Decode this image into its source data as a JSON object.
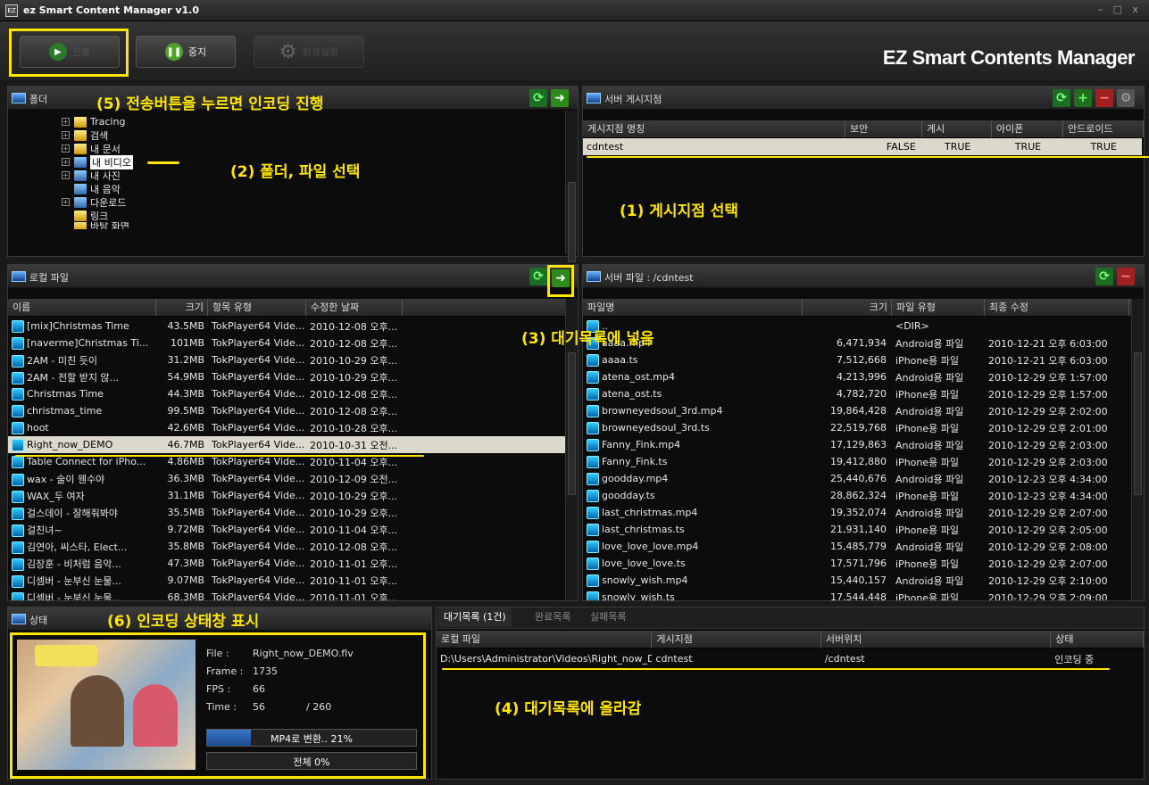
{
  "app": {
    "title": "ez Smart Content Manager v1.0",
    "icon_text": "EZ",
    "window_controls": "– □ x",
    "brand": "EZ Smart Contents Manager"
  },
  "toolbar": {
    "send_label": "전송",
    "stop_label": "중지",
    "settings_label": "환경설정"
  },
  "annotations": {
    "a1": "(1) 게시지점 선택",
    "a2": "(2) 폴더, 파일 선택",
    "a3": "(3) 대기목록에 넣음",
    "a4": "(4) 대기목록에 올라감",
    "a5": "(5) 전송버튼을 누르면 인코딩 진행",
    "a6": "(6) 인코딩 상태창 표시"
  },
  "folder_panel": {
    "title": "폴더",
    "tree": [
      "Tracing",
      "검색",
      "내 문서",
      "내 비디오",
      "내 사진",
      "내 음악",
      "다운로드",
      "링크",
      "바탕 화면"
    ]
  },
  "server_points": {
    "title": "서버 게시지점",
    "columns": [
      "게시지점 명칭",
      "보안",
      "게시",
      "아이폰",
      "안드로이드"
    ],
    "rows": [
      [
        "cdntest",
        "FALSE",
        "TRUE",
        "TRUE",
        "TRUE"
      ]
    ]
  },
  "local_files": {
    "title": "로컬 파일",
    "columns": [
      "이름",
      "크기",
      "항목 유형",
      "수정한 날짜"
    ],
    "rows": [
      [
        "[mix]Christmas Time",
        "43.5MB",
        "TokPlayer64 Vide...",
        "2010-12-08 오후..."
      ],
      [
        "[naverme]Christmas Ti...",
        "101MB",
        "TokPlayer64 Vide...",
        "2010-12-08 오후..."
      ],
      [
        "2AM - 미친 듯이",
        "31.2MB",
        "TokPlayer64 Vide...",
        "2010-10-29 오후..."
      ],
      [
        "2AM - 전할 받지 않...",
        "54.9MB",
        "TokPlayer64 Vide...",
        "2010-10-29 오후..."
      ],
      [
        "Christmas Time",
        "44.3MB",
        "TokPlayer64 Vide...",
        "2010-12-08 오후..."
      ],
      [
        "christmas_time",
        "99.5MB",
        "TokPlayer64 Vide...",
        "2010-12-08 오후..."
      ],
      [
        "hoot",
        "42.6MB",
        "TokPlayer64 Vide...",
        "2010-10-28 오후..."
      ],
      [
        "Right_now_DEMO",
        "46.7MB",
        "TokPlayer64 Vide...",
        "2010-10-31 오전..."
      ],
      [
        "Table Connect for iPho...",
        "4.86MB",
        "TokPlayer64 Vide...",
        "2010-11-04 오후..."
      ],
      [
        "wax - 술이 웬수야",
        "36.3MB",
        "TokPlayer64 Vide...",
        "2010-12-09 오전..."
      ],
      [
        "WAX_두 여자",
        "31.1MB",
        "TokPlayer64 Vide...",
        "2010-10-29 오후..."
      ],
      [
        "걸스데이 - 잘해줘봐야",
        "35.5MB",
        "TokPlayer64 Vide...",
        "2010-10-29 오후..."
      ],
      [
        "걸친녀~",
        "9.72MB",
        "TokPlayer64 Vide...",
        "2010-11-04 오후..."
      ],
      [
        "김연아, 씨스타, Elect...",
        "35.8MB",
        "TokPlayer64 Vide...",
        "2010-12-08 오후..."
      ],
      [
        "김장훈 - 비처럼 음악...",
        "47.3MB",
        "TokPlayer64 Vide...",
        "2010-11-01 오후..."
      ],
      [
        "디셈버 - 눈부신 눈물...",
        "9.07MB",
        "TokPlayer64 Vide...",
        "2010-11-01 오후..."
      ],
      [
        "디셈버 - 눈부신 눈물...",
        "68.3MB",
        "TokPlayer64 Vide...",
        "2010-11-01 오후..."
      ]
    ]
  },
  "server_files": {
    "title": "서버 파일 : /cdntest",
    "columns": [
      "파일명",
      "크기",
      "파일 유형",
      "최종 수정"
    ],
    "rows": [
      [
        "..",
        "",
        "<DIR>",
        ""
      ],
      [
        "aaaa.mp4",
        "6,471,934",
        "Android용 파일",
        "2010-12-21 오후 6:03:00"
      ],
      [
        "aaaa.ts",
        "7,512,668",
        "iPhone용 파일",
        "2010-12-21 오후 6:03:00"
      ],
      [
        "atena_ost.mp4",
        "4,213,996",
        "Android용 파일",
        "2010-12-29 오후 1:57:00"
      ],
      [
        "atena_ost.ts",
        "4,782,720",
        "iPhone용 파일",
        "2010-12-29 오후 1:57:00"
      ],
      [
        "browneyedsoul_3rd.mp4",
        "19,864,428",
        "Android용 파일",
        "2010-12-29 오후 2:02:00"
      ],
      [
        "browneyedsoul_3rd.ts",
        "22,519,768",
        "iPhone용 파일",
        "2010-12-29 오후 2:01:00"
      ],
      [
        "Fanny_Fink.mp4",
        "17,129,863",
        "Android용 파일",
        "2010-12-29 오후 2:03:00"
      ],
      [
        "Fanny_Fink.ts",
        "19,412,880",
        "iPhone용 파일",
        "2010-12-29 오후 2:03:00"
      ],
      [
        "goodday.mp4",
        "25,440,676",
        "Android용 파일",
        "2010-12-23 오후 4:34:00"
      ],
      [
        "goodday.ts",
        "28,862,324",
        "iPhone용 파일",
        "2010-12-23 오후 4:34:00"
      ],
      [
        "last_christmas.mp4",
        "19,352,074",
        "Android용 파일",
        "2010-12-29 오후 2:07:00"
      ],
      [
        "last_christmas.ts",
        "21,931,140",
        "iPhone용 파일",
        "2010-12-29 오후 2:05:00"
      ],
      [
        "love_love_love.mp4",
        "15,485,779",
        "Android용 파일",
        "2010-12-29 오후 2:08:00"
      ],
      [
        "love_love_love.ts",
        "17,571,796",
        "iPhone용 파일",
        "2010-12-29 오후 2:07:00"
      ],
      [
        "snowly_wish.mp4",
        "15,440,157",
        "Android용 파일",
        "2010-12-29 오후 2:10:00"
      ],
      [
        "snowly_wish.ts",
        "17,544,448",
        "iPhone용 파일",
        "2010-12-29 오후 2:09:00"
      ]
    ]
  },
  "status": {
    "title": "상태",
    "file_label": "File :",
    "file_value": "Right_now_DEMO.flv",
    "frame_label": "Frame :",
    "frame_value": "1735",
    "fps_label": "FPS :",
    "fps_value": "66",
    "time_label": "Time :",
    "time_value": "56",
    "time_total": "/ 260",
    "progress_text": "MP4로 변환.. 21%",
    "progress_fraction": 0.21,
    "total_text": "전체 0%",
    "total_fraction": 0.0
  },
  "queue": {
    "tabs": [
      "대기목록 (1건)",
      "완료목록",
      "실패목록"
    ],
    "columns": [
      "로컬 파일",
      "게시지점",
      "서버위치",
      "상태"
    ],
    "rows": [
      [
        "D:\\Users\\Administrator\\Videos\\Right_now_D...",
        "cdntest",
        "/cdntest",
        "인코딩 중"
      ]
    ]
  },
  "colors": {
    "annotation": "#ffe600",
    "selected_row": "#ddd8cc",
    "accent_green": "#2f8a1c"
  }
}
